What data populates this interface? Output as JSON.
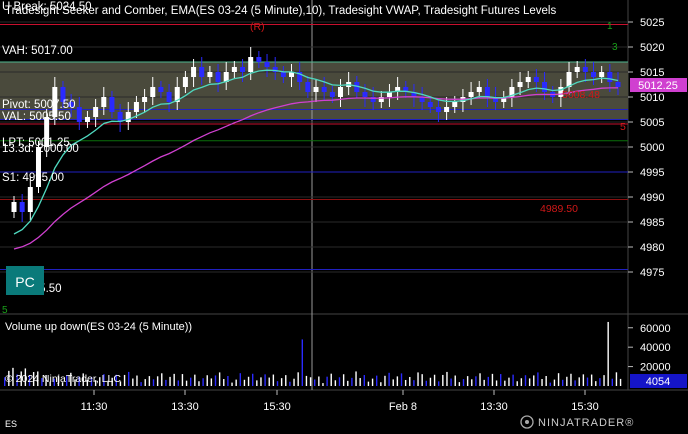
{
  "window": {
    "price_panel_title": "Tradesight Seeker and Comber, EMA(ES 03-24 (5 Minute),10), Tradesight VWAP, Tradesight Futures Levels",
    "volume_panel_title": "Volume up down(ES 03-24 (5 Minute))",
    "copyright": "© 2024 NinjaTrader, LLC",
    "instrument": "ES",
    "brand": "NINJATRADER®"
  },
  "colors": {
    "background": "#000000",
    "grid_dark": "#2a2a2a",
    "up_bar": "#ffffff",
    "down_bar": "#2a2aff",
    "vah_line": "#4fb88f",
    "value_area_fill": "#4a4a3c",
    "ema": "#4fd9c0",
    "vwap": "#d040d0",
    "resistance": "#c8102e",
    "support": "#2020c0",
    "pivot": "#2020c0",
    "lpt": "#0a6f0a",
    "pc_box": "#0a7a7a",
    "price_tag": "#d040d0",
    "volume_tag": "#1515c8"
  },
  "chart_data": [
    {
      "type": "candlestick",
      "ylim": [
        4970,
        5027
      ],
      "y_ticks": [
        5025,
        5020,
        5015,
        5010,
        5005,
        5000,
        4995,
        4990,
        4985,
        4980,
        4975
      ],
      "x_ticks": [
        "11:30",
        "13:30",
        "15:30",
        "Feb 8",
        "13:30",
        "15:30"
      ],
      "close_series": [
        4989,
        4987,
        4992,
        5000,
        5006,
        5012,
        5009,
        5008,
        5005,
        5006,
        5008,
        5010,
        5007,
        5005,
        5007,
        5009,
        5010,
        5012,
        5011,
        5009,
        5012,
        5014,
        5016,
        5014,
        5015,
        5013,
        5015,
        5016,
        5015,
        5018,
        5017,
        5016,
        5015,
        5014,
        5015,
        5013,
        5011,
        5012,
        5011,
        5010,
        5012,
        5013,
        5011,
        5010,
        5009,
        5010,
        5011,
        5012,
        5011,
        5010,
        5009,
        5008,
        5007,
        5008,
        5009,
        5010,
        5011,
        5012,
        5010,
        5009,
        5010,
        5012,
        5013,
        5014,
        5013,
        5011,
        5010,
        5012,
        5015,
        5016,
        5015,
        5014,
        5015,
        5013,
        5012
      ],
      "levels": [
        {
          "label": "U Break: 5024.50",
          "value": 5024.5,
          "kind": "resistance"
        },
        {
          "label": "VAH: 5017.00",
          "value": 5017.0,
          "kind": "vah"
        },
        {
          "label": "Pivot: 5007.50",
          "value": 5007.5,
          "kind": "pivot"
        },
        {
          "label": "VAL: 5005.50",
          "value": 5005.5,
          "kind": "val"
        },
        {
          "label": "LPT: 5001.25",
          "value": 5001.25,
          "kind": "lpt"
        },
        {
          "label": "S1: 4995.00",
          "value": 4995.0,
          "kind": "support"
        },
        {
          "label": "4975.50",
          "value": 4975.5,
          "kind": "support"
        }
      ],
      "overlapping_label": "13.3d: 2000.00",
      "mid_label": "4989.50",
      "vwap_label": "5008.48",
      "current_price_tag": "5012.25",
      "resistance_right_tag": "5",
      "signal_labels": [
        "(R)",
        "1",
        "3",
        "5"
      ],
      "pc_label": "PC"
    },
    {
      "type": "bar",
      "ylim": [
        0,
        68000
      ],
      "y_ticks": [
        60000,
        40000,
        20000
      ],
      "current_volume_tag": "4054",
      "spikes": [
        48000,
        38000,
        66000
      ]
    }
  ]
}
